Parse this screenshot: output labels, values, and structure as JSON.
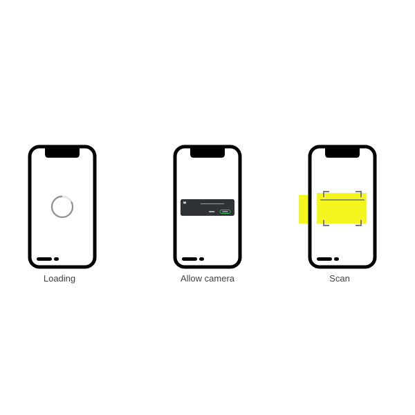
{
  "steps": [
    {
      "label": "Loading"
    },
    {
      "label": "Allow camera"
    },
    {
      "label": "Scan"
    }
  ],
  "dialog": {
    "title": "",
    "deny_label": "",
    "allow_label": ""
  },
  "colors": {
    "phone_outline": "#000000",
    "dialog_bg": "#2f3338",
    "dialog_text": "#c8ccd2",
    "allow_ring": "#35c15a",
    "highlight": "#f3f71f",
    "spinner_track": "#8e8e8e",
    "spinner_head": "#e4e4e4",
    "caption_text": "#444444"
  },
  "icons": [
    "spinner-icon",
    "camera-icon",
    "scan-frame-icon"
  ]
}
